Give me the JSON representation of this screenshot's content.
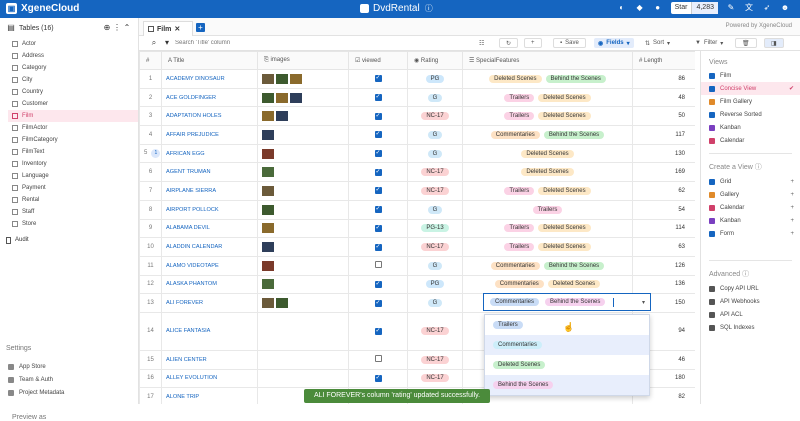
{
  "topbar": {
    "brand": "XgeneCloud",
    "project": "DvdRental",
    "star_label": "Star",
    "star_count": "4,283",
    "powered_by": "Powered by XgeneCloud"
  },
  "sidebar": {
    "tables_label": "Tables (16)",
    "tables": [
      "Actor",
      "Address",
      "Category",
      "City",
      "Country",
      "Customer",
      "Film",
      "FilmActor",
      "FilmCategory",
      "FilmText",
      "Inventory",
      "Language",
      "Payment",
      "Rental",
      "Staff",
      "Store"
    ],
    "active_table": "Film",
    "audit_label": "Audit",
    "settings_label": "Settings",
    "settings_items": [
      "App Store",
      "Team & Auth",
      "Project Metadata"
    ],
    "preview_label": "Preview as"
  },
  "tabbar": {
    "tab_label": "Film"
  },
  "toolbar": {
    "search_placeholder": "Search 'Title' column",
    "save_label": "Save",
    "fields_label": "Fields",
    "sort_label": "Sort",
    "filter_label": "Filter"
  },
  "grid": {
    "headers": [
      "#",
      "Title",
      "images",
      "viewed",
      "Rating",
      "SpecialFeatures",
      "Length"
    ],
    "rows": [
      {
        "n": "1",
        "title": "ACADEMY DINOSAUR",
        "images": 3,
        "viewed": true,
        "rating": "PG",
        "features": [
          "Deleted Scenes",
          "Behind the Scenes"
        ],
        "length": "86"
      },
      {
        "n": "2",
        "title": "ACE GOLDFINGER",
        "images": 3,
        "viewed": true,
        "rating": "G",
        "features": [
          "Trailers",
          "Deleted Scenes"
        ],
        "length": "48"
      },
      {
        "n": "3",
        "title": "ADAPTATION HOLES",
        "images": 2,
        "viewed": true,
        "rating": "NC-17",
        "features": [
          "Trailers",
          "Deleted Scenes"
        ],
        "length": "50"
      },
      {
        "n": "4",
        "title": "AFFAIR PREJUDICE",
        "images": 1,
        "viewed": true,
        "rating": "G",
        "features": [
          "Commentaries",
          "Behind the Scenes"
        ],
        "length": "117"
      },
      {
        "n": "5",
        "title": "AFRICAN EGG",
        "images": 1,
        "viewed": true,
        "rating": "G",
        "features": [
          "Deleted Scenes"
        ],
        "length": "130",
        "badge": "1"
      },
      {
        "n": "6",
        "title": "AGENT TRUMAN",
        "images": 1,
        "viewed": true,
        "rating": "NC-17",
        "features": [
          "Deleted Scenes"
        ],
        "length": "169"
      },
      {
        "n": "7",
        "title": "AIRPLANE SIERRA",
        "images": 1,
        "viewed": true,
        "rating": "NC-17",
        "features": [
          "Trailers",
          "Deleted Scenes"
        ],
        "length": "62"
      },
      {
        "n": "8",
        "title": "AIRPORT POLLOCK",
        "images": 1,
        "viewed": true,
        "rating": "G",
        "features": [
          "Trailers"
        ],
        "length": "54"
      },
      {
        "n": "9",
        "title": "ALABAMA DEVIL",
        "images": 1,
        "viewed": true,
        "rating": "PG-13",
        "features": [
          "Trailers",
          "Deleted Scenes"
        ],
        "length": "114"
      },
      {
        "n": "10",
        "title": "ALADDIN CALENDAR",
        "images": 1,
        "viewed": true,
        "rating": "NC-17",
        "features": [
          "Trailers",
          "Deleted Scenes"
        ],
        "length": "63"
      },
      {
        "n": "11",
        "title": "ALAMO VIDEOTAPE",
        "images": 1,
        "viewed": false,
        "rating": "G",
        "features": [
          "Commentaries",
          "Behind the Scenes"
        ],
        "length": "126"
      },
      {
        "n": "12",
        "title": "ALASKA PHANTOM",
        "images": 1,
        "viewed": true,
        "rating": "PG",
        "features": [
          "Commentaries",
          "Deleted Scenes"
        ],
        "length": "136"
      },
      {
        "n": "13",
        "title": "ALI FOREVER",
        "images": 2,
        "viewed": true,
        "rating": "G",
        "features": [],
        "length": "150"
      },
      {
        "n": "14",
        "title": "ALICE FANTASIA",
        "images": 0,
        "viewed": true,
        "rating": "NC-17",
        "features": [],
        "length": "94"
      },
      {
        "n": "15",
        "title": "ALIEN CENTER",
        "images": 0,
        "viewed": false,
        "rating": "NC-17",
        "features": [],
        "length": "46"
      },
      {
        "n": "16",
        "title": "ALLEY EVOLUTION",
        "images": 0,
        "viewed": true,
        "rating": "NC-17",
        "features": [],
        "length": "180"
      },
      {
        "n": "17",
        "title": "ALONE TRIP",
        "images": 0,
        "viewed": false,
        "rating": "R",
        "features": [],
        "length": "82"
      }
    ]
  },
  "editor": {
    "selected": [
      "Commentaries",
      "Behind the Scenes"
    ],
    "options": [
      "Trailers",
      "Commentaries",
      "Deleted Scenes",
      "Behind the Scenes"
    ]
  },
  "toast": "ALI FOREVER's column 'rating' updated successfully.",
  "rightpanel": {
    "views_label": "Views",
    "views": [
      "Film",
      "Concise View",
      "Film Gallery",
      "Reverse Sorted",
      "Kanban",
      "Calendar"
    ],
    "active_view": "Concise View",
    "create_label": "Create a View",
    "create_items": [
      "Grid",
      "Gallery",
      "Calendar",
      "Kanban",
      "Form"
    ],
    "advanced_label": "Advanced",
    "advanced_items": [
      "Copy API URL",
      "API Webhooks",
      "API ACL",
      "SQL Indexes"
    ]
  },
  "colors": {
    "brand": "#1565c0",
    "active": "#d0406a",
    "toast": "#4b8b3b"
  }
}
